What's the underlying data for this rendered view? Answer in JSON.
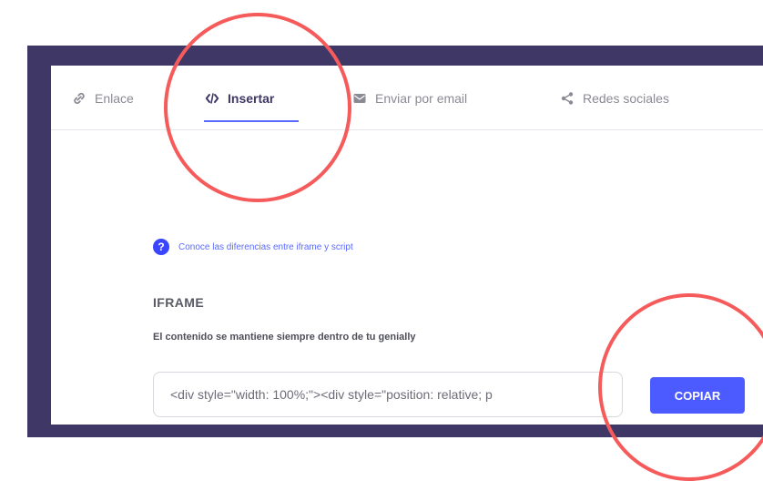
{
  "tabs": [
    {
      "label": "Enlace",
      "icon": "link-icon",
      "active": false
    },
    {
      "label": "Insertar",
      "icon": "code-icon",
      "active": true
    },
    {
      "label": "Enviar por email",
      "icon": "email-icon",
      "active": false
    },
    {
      "label": "Redes sociales",
      "icon": "share-icon",
      "active": false
    }
  ],
  "help": {
    "icon": "question-icon",
    "text": "Conoce las diferencias entre iframe y script"
  },
  "iframe": {
    "title": "IFRAME",
    "description": "El contenido se mantiene siempre dentro de tu genially",
    "code_value": "<div style=\"width: 100%;\"><div style=\"position: relative; p"
  },
  "copy_button": {
    "label": "COPIAR"
  },
  "colors": {
    "frame": "#3f3766",
    "accent": "#4b5bff",
    "annotation": "#f65b5b"
  }
}
